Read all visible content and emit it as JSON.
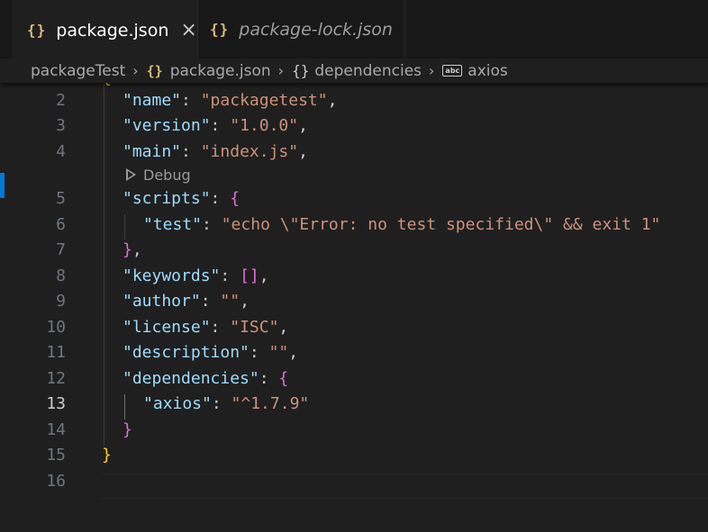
{
  "tabs": [
    {
      "icon": "{}",
      "label": "package.json",
      "close": "×"
    },
    {
      "icon": "{}",
      "label": "package-lock.json"
    }
  ],
  "breadcrumb": {
    "folder": "packageTest",
    "file_icon": "{}",
    "file": "package.json",
    "obj_icon": "{}",
    "object": "dependencies",
    "prop_icon": "abc",
    "property": "axios"
  },
  "editor": {
    "top_partial": "{",
    "codelens": "Debug",
    "current_line": 13,
    "lines": [
      {
        "n": "2",
        "key": "\"name\"",
        "sep": ": ",
        "val": "\"packagetest\"",
        "tail": ","
      },
      {
        "n": "3",
        "key": "\"version\"",
        "sep": ": ",
        "val": "\"1.0.0\"",
        "tail": ","
      },
      {
        "n": "4",
        "key": "\"main\"",
        "sep": ": ",
        "val": "\"index.js\"",
        "tail": ","
      },
      {
        "n": "5",
        "key": "\"scripts\"",
        "sep": ": ",
        "open": "{"
      },
      {
        "n": "6",
        "key": "\"test\"",
        "sep": ": ",
        "val": "\"echo \\\"Error: no test specified\\\" && exit 1\""
      },
      {
        "n": "7",
        "close": "}",
        "tail": ","
      },
      {
        "n": "8",
        "key": "\"keywords\"",
        "sep": ": ",
        "arr": "[]",
        "tail": ","
      },
      {
        "n": "9",
        "key": "\"author\"",
        "sep": ": ",
        "val": "\"\"",
        "tail": ","
      },
      {
        "n": "10",
        "key": "\"license\"",
        "sep": ": ",
        "val": "\"ISC\"",
        "tail": ","
      },
      {
        "n": "11",
        "key": "\"description\"",
        "sep": ": ",
        "val": "\"\"",
        "tail": ","
      },
      {
        "n": "12",
        "key": "\"dependencies\"",
        "sep": ": ",
        "open": "{"
      },
      {
        "n": "13",
        "key": "\"axios\"",
        "sep": ": ",
        "val": "\"^1.7.9\""
      },
      {
        "n": "14",
        "close": "}"
      },
      {
        "n": "15",
        "close_root": "}"
      },
      {
        "n": "16"
      }
    ]
  },
  "colors": {
    "key": "#9cdcfe",
    "string": "#ce9178",
    "brace_l1": "#ffd700",
    "brace_l2": "#da70d6",
    "bracket": "#179fff",
    "accent": "#0078d4"
  }
}
